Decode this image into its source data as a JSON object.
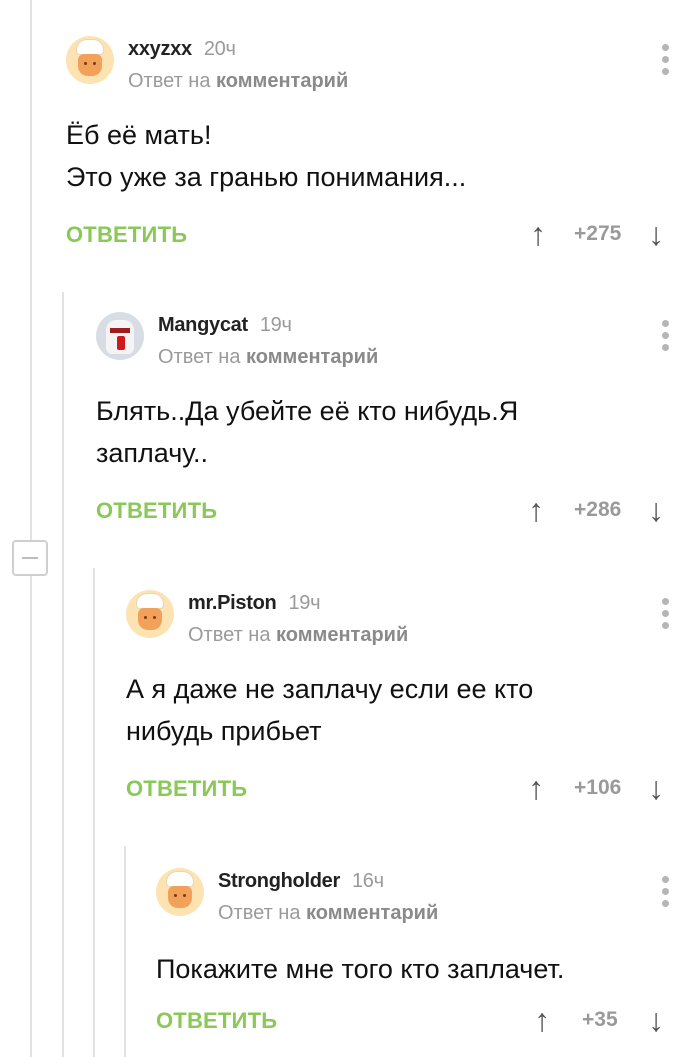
{
  "comments": [
    {
      "author": "xxyzxx",
      "time": "20ч",
      "reply_prefix": "Ответ на",
      "reply_target": "комментарий",
      "text_lines": [
        "Ёб её мать!",
        "Это уже за гранью понимания..."
      ],
      "reply_label": "ОТВЕТИТЬ",
      "rating": "+275",
      "avatar": "chef-avatar-icon"
    },
    {
      "author": "Mangycat",
      "time": "19ч",
      "reply_prefix": "Ответ на",
      "reply_target": "комментарий",
      "text_lines": [
        "Блять..Да убейте её кто нибудь.Я",
        "заплачу.."
      ],
      "reply_label": "ОТВЕТИТЬ",
      "rating": "+286",
      "avatar": "cat-avatar-icon"
    },
    {
      "author": "mr.Piston",
      "time": "19ч",
      "reply_prefix": "Ответ на",
      "reply_target": "комментарий",
      "text_lines": [
        "А я даже не заплачу если ее кто",
        "нибудь прибьет"
      ],
      "reply_label": "ОТВЕТИТЬ",
      "rating": "+106",
      "avatar": "chef-avatar-icon"
    },
    {
      "author": "Strongholder",
      "time": "16ч",
      "reply_prefix": "Ответ на",
      "reply_target": "комментарий",
      "text_lines": [
        "Покажите мне того кто заплачет."
      ],
      "reply_label": "ОТВЕТИТЬ",
      "rating": "+35",
      "avatar": "chef-avatar-icon"
    }
  ],
  "icons": {
    "upvote": "↑",
    "downvote": "↓",
    "collapse": "minus-icon",
    "menu": "more-vertical-icon"
  },
  "colors": {
    "reply_green": "#8ac858",
    "thread_line": "#e2e2e2",
    "muted_text": "#9a9a9a"
  }
}
